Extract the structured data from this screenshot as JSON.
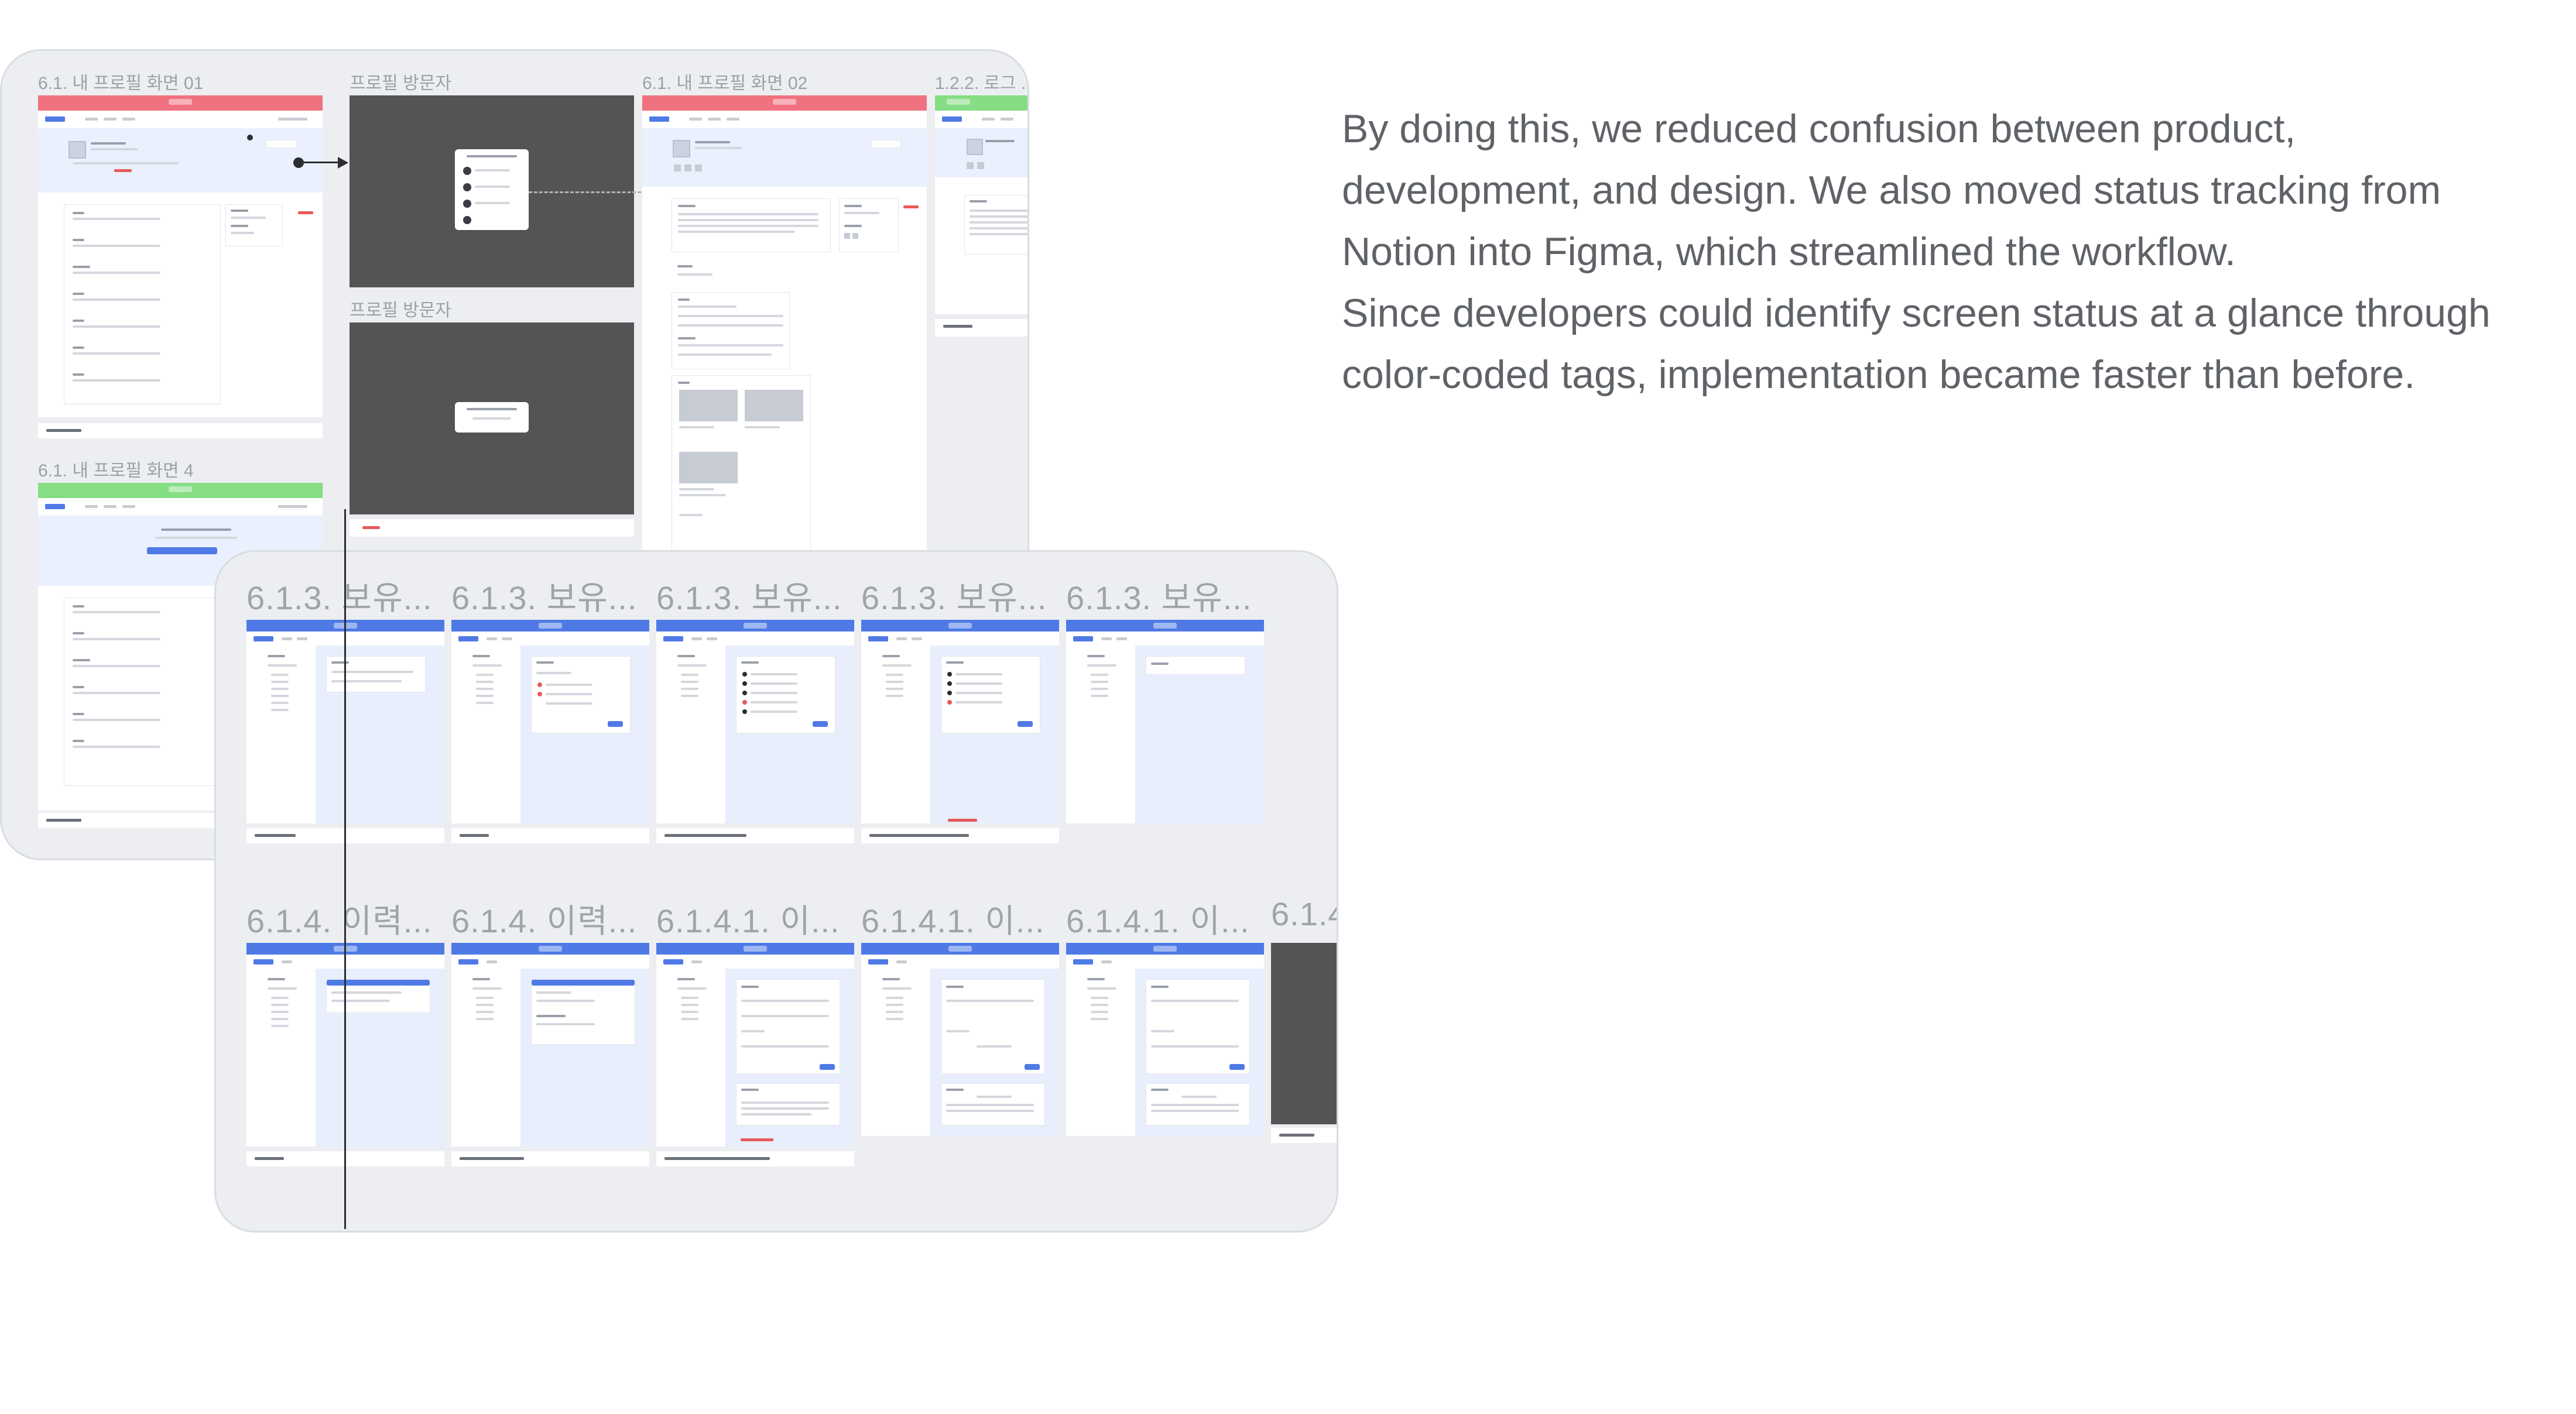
{
  "panel_a": {
    "frames": [
      {
        "label": "6.1. 내 프로필 화면 01"
      },
      {
        "label": "프로필 방문자"
      },
      {
        "label": "6.1. 내 프로필 화면 02"
      },
      {
        "label": "1.2.2. 로그 ..."
      },
      {
        "label": "프로필 방문자"
      },
      {
        "label": "6.1. 내 프로필 화면 4"
      }
    ]
  },
  "panel_b": {
    "row1": [
      {
        "label": "6.1.3. 보유..."
      },
      {
        "label": "6.1.3. 보유..."
      },
      {
        "label": "6.1.3. 보유..."
      },
      {
        "label": "6.1.3. 보유..."
      },
      {
        "label": "6.1.3. 보유..."
      }
    ],
    "row2": [
      {
        "label": "6.1.4. 이력..."
      },
      {
        "label": "6.1.4. 이력..."
      },
      {
        "label": "6.1.4.1. 이..."
      },
      {
        "label": "6.1.4.1. 이..."
      },
      {
        "label": "6.1.4.1. 이..."
      },
      {
        "label": "6.1.4"
      }
    ]
  },
  "status_colors": {
    "red": "#f0717f",
    "green": "#85dd84",
    "blue": "#4f7ae6"
  },
  "description": {
    "lines": [
      "By doing this, we reduced confusion between product,",
      "development, and design. We also moved status tracking from",
      "Notion into Figma, which streamlined the workflow.",
      "Since developers could identify screen status at a glance through",
      "color-coded tags, implementation became faster than before."
    ]
  }
}
